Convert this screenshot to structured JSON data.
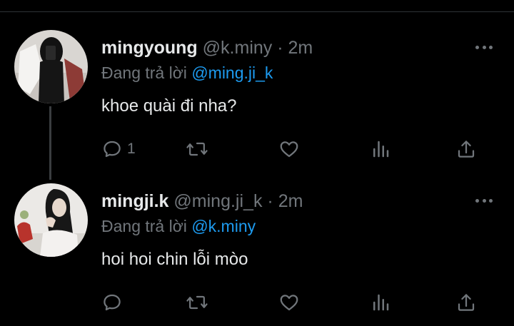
{
  "colors": {
    "background": "#000000",
    "text_primary": "#e7e9ea",
    "text_secondary": "#71767b",
    "accent_link": "#1d9bf0",
    "divider": "#2f3336"
  },
  "tweets": [
    {
      "name": "mingyoung",
      "handle": "@k.miny",
      "separator": "·",
      "time": "2m",
      "reply_prefix": "Đang trả lời",
      "reply_mention": "@ming.ji_k",
      "text": "khoe quài đi nha?",
      "reply_count": "1",
      "icons": [
        "reply-icon",
        "retweet-icon",
        "like-icon",
        "views-icon",
        "share-icon",
        "more-icon"
      ]
    },
    {
      "name": "mingji.k",
      "handle": "@ming.ji_k",
      "separator": "·",
      "time": "2m",
      "reply_prefix": "Đang trả lời",
      "reply_mention": "@k.miny",
      "text": "hoi hoi chin lỗi mòo",
      "reply_count": "",
      "icons": [
        "reply-icon",
        "retweet-icon",
        "like-icon",
        "views-icon",
        "share-icon",
        "more-icon"
      ]
    }
  ]
}
